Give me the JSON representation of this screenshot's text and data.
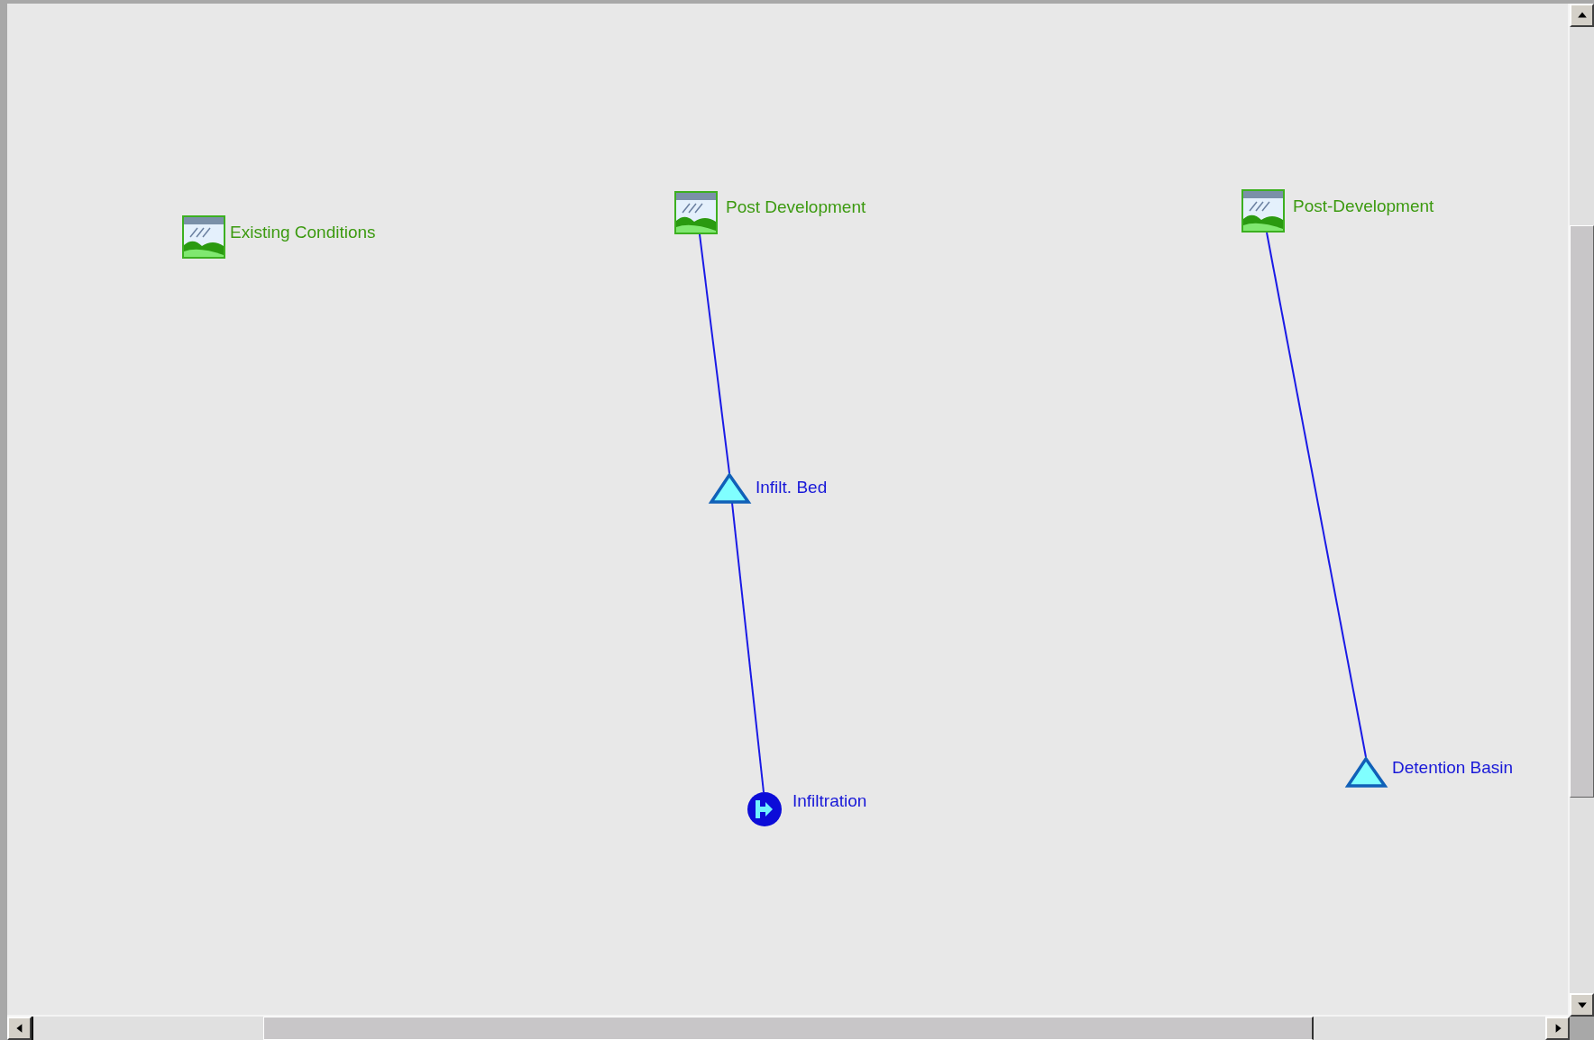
{
  "map": {
    "nodes": [
      {
        "kind": "subcatchment",
        "label": "Existing Conditions"
      },
      {
        "kind": "subcatchment",
        "label": "Post Development",
        "children": [
          {
            "kind": "pond",
            "label": "Infilt. Bed",
            "children": [
              {
                "kind": "link",
                "label": "Infiltration"
              }
            ]
          }
        ]
      },
      {
        "kind": "subcatchment",
        "label": "Post-Development",
        "children": [
          {
            "kind": "pond",
            "label": "Detention Basin"
          }
        ]
      }
    ]
  }
}
